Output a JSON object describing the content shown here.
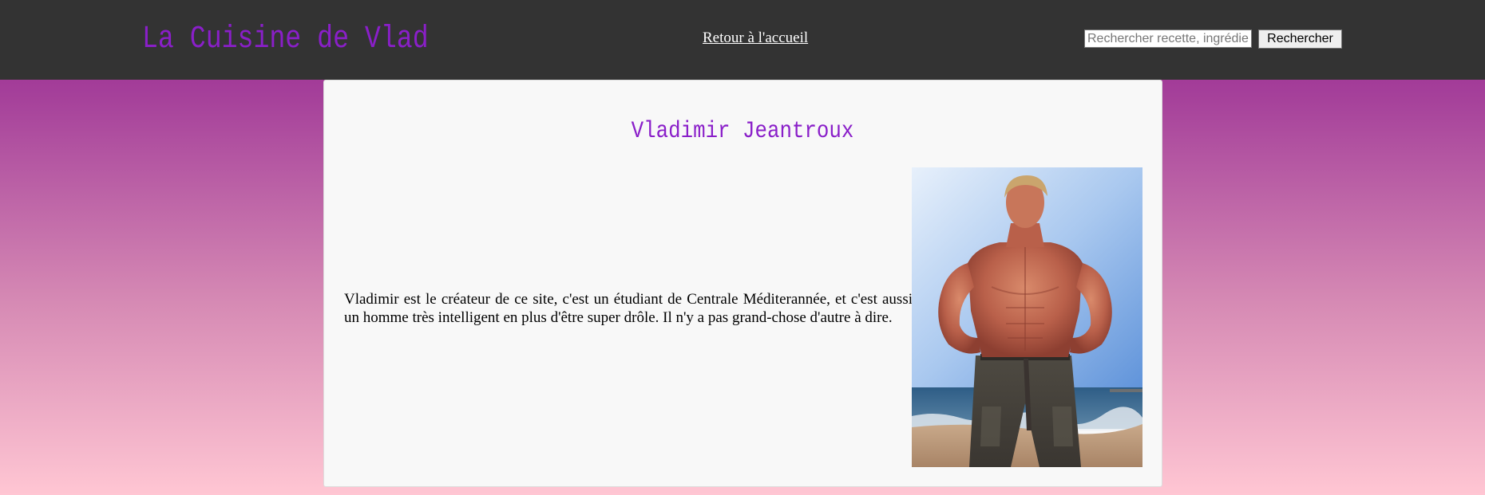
{
  "header": {
    "logo": "La Cuisine de Vlad",
    "home_link": "Retour à l'accueil",
    "search": {
      "placeholder": "Rechercher recette, ingrédient",
      "value": "",
      "button_label": "Rechercher"
    }
  },
  "profile": {
    "name": "Vladimir Jeantroux",
    "bio": "Vladimir est le créateur de ce site, c'est un étudiant de Centrale Méditerannée, et c'est aussi un homme très intelligent en plus d'être super drôle. Il n'y a pas grand-chose d'autre à dire.",
    "photo_icon": "muscular-man-beach-photo"
  },
  "colors": {
    "accent": "#8a1fc9",
    "header_bg": "#333333",
    "gradient_top": "#962490",
    "gradient_bottom": "#ffc6d3",
    "card_bg": "#f8f8f8"
  }
}
